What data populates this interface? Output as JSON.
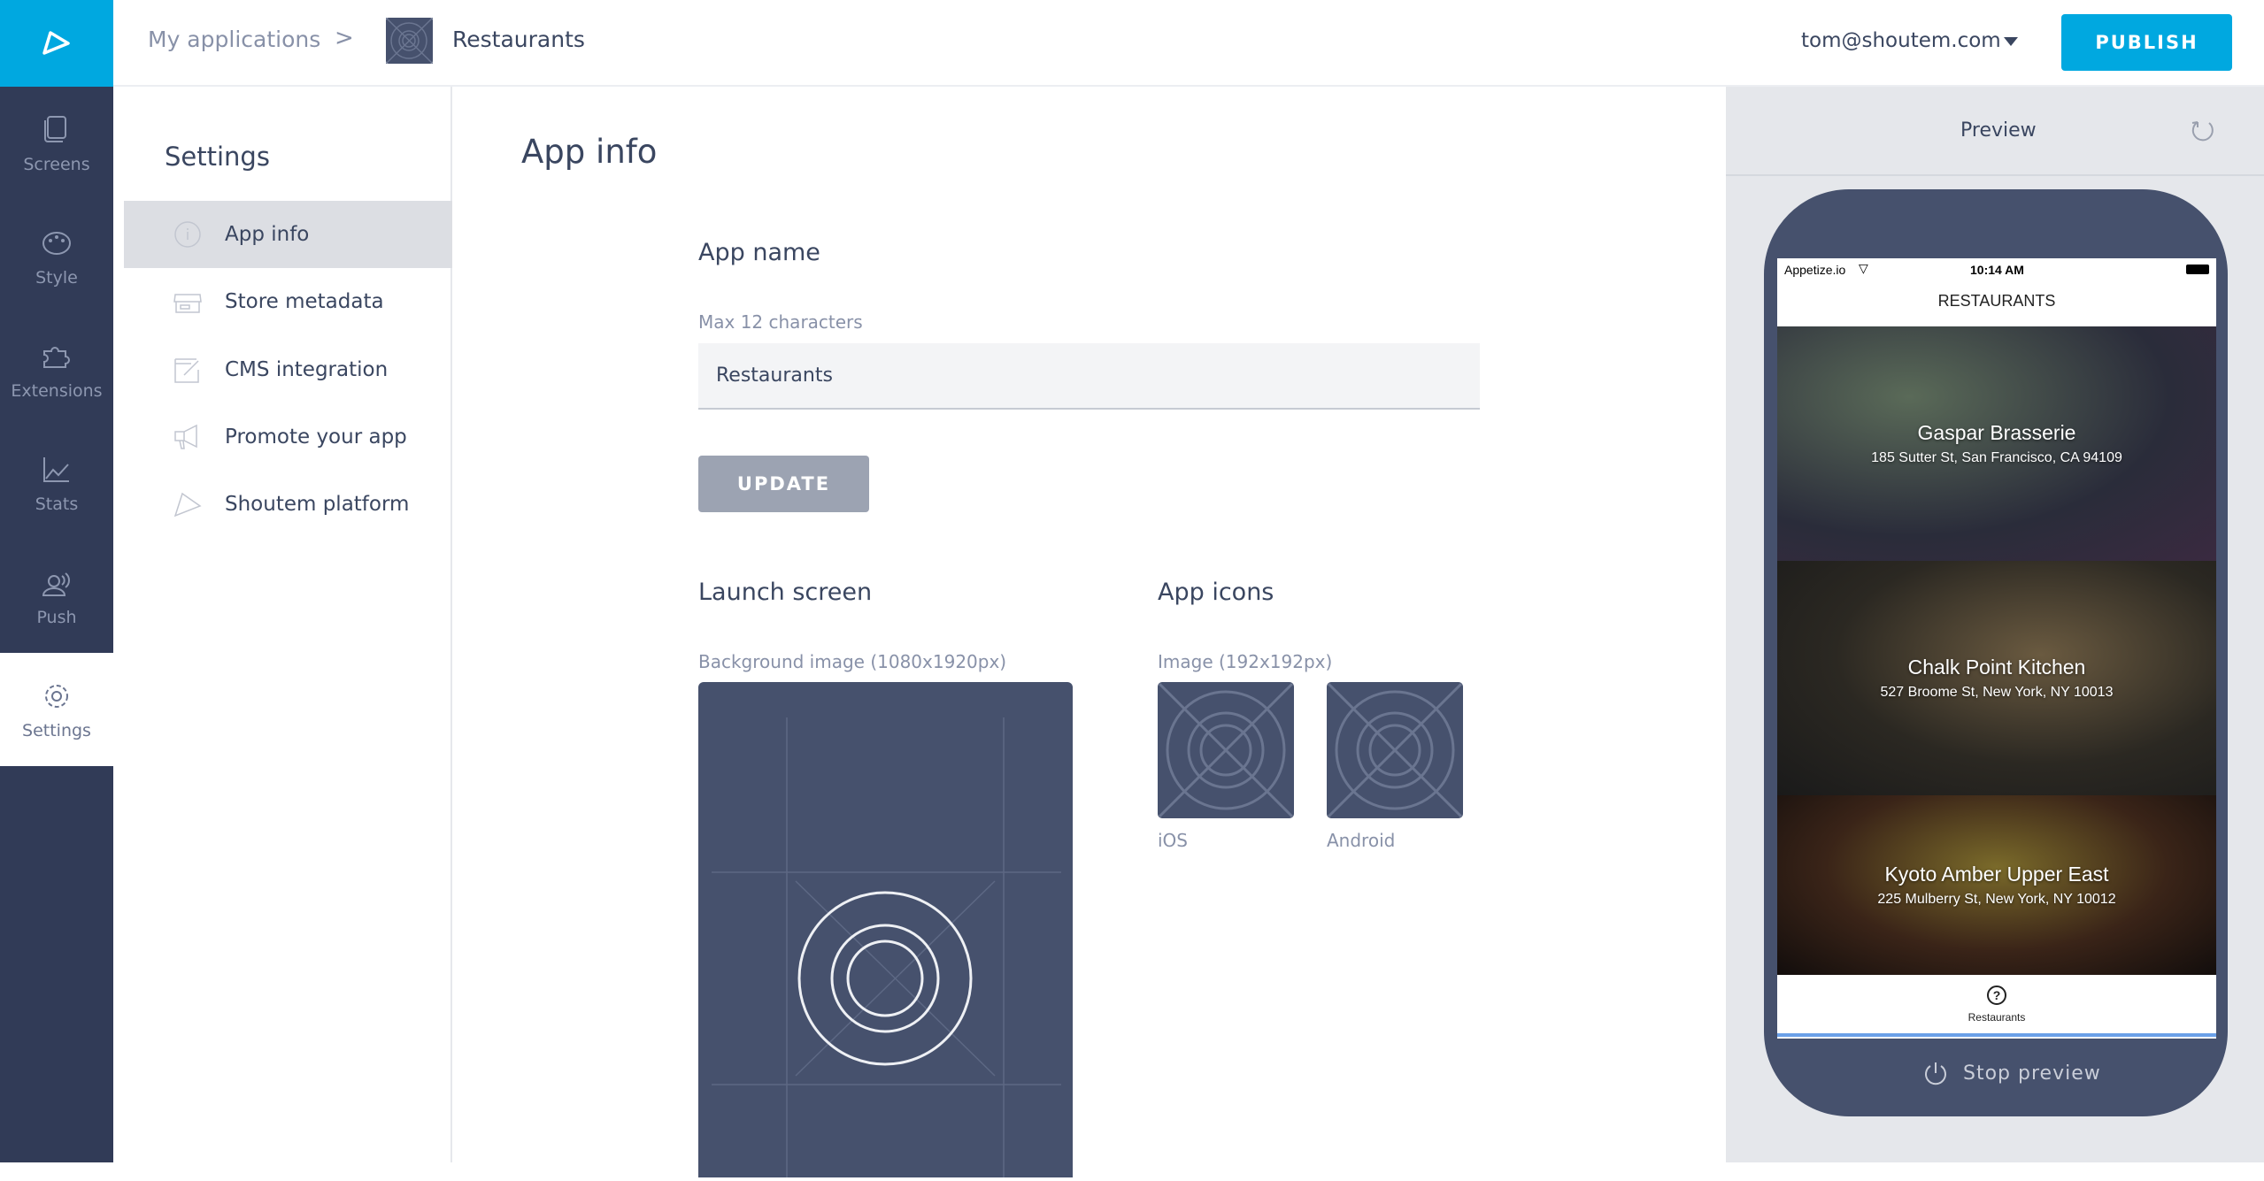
{
  "nav": {
    "items": [
      {
        "label": "Screens",
        "icon": "screens-icon"
      },
      {
        "label": "Style",
        "icon": "palette-icon"
      },
      {
        "label": "Extensions",
        "icon": "puzzle-icon"
      },
      {
        "label": "Stats",
        "icon": "chart-icon"
      },
      {
        "label": "Push",
        "icon": "push-icon"
      },
      {
        "label": "Settings",
        "icon": "gear-icon"
      }
    ],
    "active": "Settings"
  },
  "topbar": {
    "breadcrumb_root": "My applications",
    "breadcrumb_sep": ">",
    "app_name": "Restaurants",
    "user_email": "tom@shoutem.com",
    "publish_label": "PUBLISH"
  },
  "settings": {
    "title": "Settings",
    "items": [
      {
        "label": "App info"
      },
      {
        "label": "Store metadata"
      },
      {
        "label": "CMS integration"
      },
      {
        "label": "Promote your app"
      },
      {
        "label": "Shoutem platform"
      }
    ]
  },
  "main": {
    "title": "App info",
    "app_name_heading": "App name",
    "app_name_hint": "Max 12 characters",
    "app_name_value": "Restaurants",
    "update_label": "UPDATE",
    "launch_heading": "Launch screen",
    "launch_hint": "Background image (1080x1920px)",
    "icons_heading": "App icons",
    "icons_hint": "Image (192x192px)",
    "ios_label": "iOS",
    "android_label": "Android"
  },
  "preview": {
    "title": "Preview",
    "stop_label": "Stop preview",
    "status_carrier": "Appetize.io",
    "status_time": "10:14 AM",
    "screen_title": "RESTAURANTS",
    "tab_label": "Restaurants",
    "restaurants": [
      {
        "name": "Gaspar Brasserie",
        "address": "185 Sutter St, San Francisco, CA 94109"
      },
      {
        "name": "Chalk Point Kitchen",
        "address": "527 Broome St, New York, NY 10013"
      },
      {
        "name": "Kyoto Amber Upper East",
        "address": "225 Mulberry St, New York, NY 10012"
      }
    ]
  },
  "colors": {
    "accent": "#00a8e0",
    "nav_bg": "#313b57",
    "placeholder_bg": "#46516d"
  }
}
